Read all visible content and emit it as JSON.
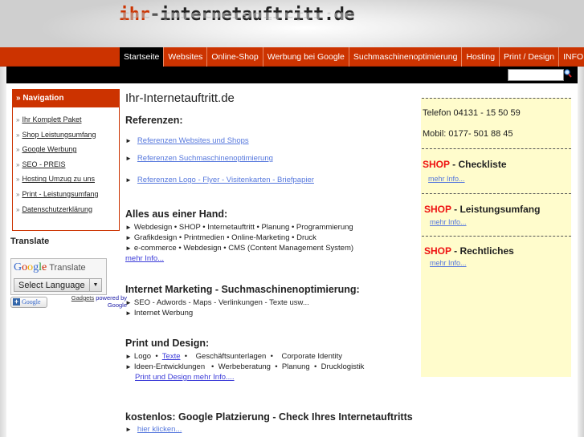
{
  "header": {
    "logo_accent": "ihr",
    "logo_rest": "-internetauftritt.de"
  },
  "nav": {
    "items": [
      {
        "label": "Startseite",
        "active": true
      },
      {
        "label": "Websites"
      },
      {
        "label": "Online-Shop"
      },
      {
        "label": "Werbung bei Google"
      },
      {
        "label": "Suchmaschinenoptimierung"
      },
      {
        "label": "Hosting"
      },
      {
        "label": "Print / Design"
      },
      {
        "label": "INFO"
      }
    ]
  },
  "search": {
    "value": "",
    "icon": "search-icon"
  },
  "sidebar": {
    "title": "» Navigation",
    "items": [
      {
        "label": "Ihr Komplett Paket"
      },
      {
        "label": "Shop Leistungsumfang"
      },
      {
        "label": "Google Werbung"
      },
      {
        "label": "SEO - PREIS"
      },
      {
        "label": "Hosting Umzug zu uns"
      },
      {
        "label": "Print - Leistungsumfang"
      },
      {
        "label": "Datenschutzerklärung"
      }
    ],
    "bullet": "»"
  },
  "translate": {
    "title": "Translate",
    "logo_letters": [
      "G",
      "o",
      "o",
      "g",
      "l",
      "e"
    ],
    "logo_suffix": "Translate",
    "select_value": "Select Language",
    "plus_label": "Google",
    "gadgets_link": "Gadgets",
    "powered_by": "powered by",
    "google": "Google"
  },
  "main": {
    "title": "Ihr-Internetauftritt.de",
    "referenzen": {
      "heading": "Referenzen:",
      "links": [
        "Referenzen Websites und Shops",
        "Referenzen Suchmaschinenoptimierung",
        "Referenzen Logo - Flyer - Visitenkarten - Briefpapier"
      ]
    },
    "alles": {
      "heading": "Alles aus einer Hand:",
      "lines": [
        "Webdesign  •  SHOP  •  Internetauftritt   •   Planung  •  Programmierung",
        "Grafikdesign  •  Printmedien  •  Online-Marketing  •  Druck",
        "e-commerce  •  Webdesign  •  CMS (Content Management System)"
      ],
      "more": "mehr Info..."
    },
    "marketing": {
      "heading": "Internet Marketing - Suchmaschinenoptimierung:",
      "lines": [
        "SEO  - Adwords - Maps - Verlinkungen - Texte usw...",
        "Internet Werbung"
      ]
    },
    "print": {
      "heading": "Print und Design:",
      "line1_a": "Logo  •  ",
      "line1_link": "Texte",
      "line1_b": "  •    Geschäftsunterlagen  •    Corporate Identity",
      "line2": "Ideen-Entwicklungen   •  Werbeberatung  •  Planung  •  Drucklogistik",
      "more": "Print und Design mehr Info...."
    },
    "kostenlos": {
      "heading": "kostenlos:  Google Platzierung - Check Ihres Internetauftritts",
      "link": "hier klicken..."
    },
    "bullet": "►"
  },
  "right": {
    "phone": "Telefon 04131 - 15 50 59",
    "mobile": "Mobil:   0177-  501 88 45",
    "items": [
      {
        "shop": "SHOP",
        "rest": " - Checkliste",
        "link": "mehr Info..."
      },
      {
        "shop": "SHOP",
        "rest": " - Leistungsumfang",
        "link": "mehr Info..."
      },
      {
        "shop": "SHOP",
        "rest": " - Rechtliches",
        "link": "mehr Info..."
      }
    ]
  },
  "colors": {
    "brand": "#cc3300",
    "nav_active": "#000000",
    "sidebar_right_bg": "#fffccc",
    "shop_red": "#ee1111",
    "link_blue": "#5577dd"
  }
}
